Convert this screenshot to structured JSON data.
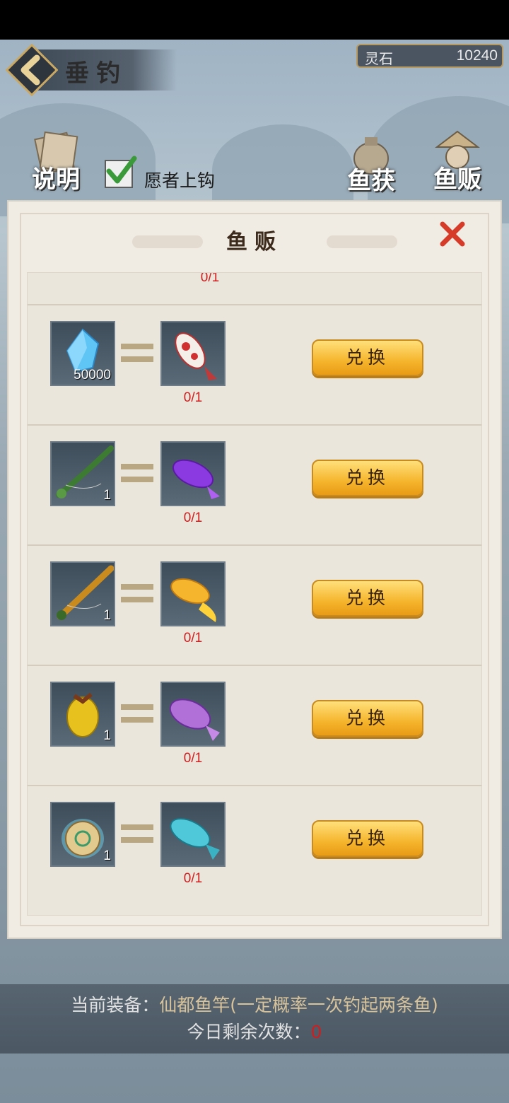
{
  "header": {
    "title": "垂钓",
    "currency_label": "灵石",
    "currency_value": "10240"
  },
  "toolbar": {
    "help_label": "说明",
    "catch_label": "鱼获",
    "vendor_label": "鱼贩",
    "auto_hook_label": "愿者上钩",
    "auto_hook_checked": true
  },
  "modal": {
    "title": "鱼贩",
    "top_partial_progress": "0/1",
    "exchange_label": "兑换",
    "rows": [
      {
        "cost_icon": "spirit-crystal-icon",
        "cost_count": "50000",
        "reward_icon": "koi-fish-icon",
        "progress": "0/1"
      },
      {
        "cost_icon": "green-bamboo-rod-icon",
        "cost_count": "1",
        "reward_icon": "purple-arowana-icon",
        "progress": "0/1"
      },
      {
        "cost_icon": "golden-rod-icon",
        "cost_count": "1",
        "reward_icon": "golden-arowana-icon",
        "progress": "0/1"
      },
      {
        "cost_icon": "golden-fruit-bait-icon",
        "cost_count": "1",
        "reward_icon": "purple-carp-icon",
        "progress": "0/1"
      },
      {
        "cost_icon": "jade-pouch-icon",
        "cost_count": "1",
        "reward_icon": "cyan-carp-icon",
        "progress": "0/1"
      }
    ]
  },
  "footer": {
    "equip_label": "当前装备：",
    "equip_value": "仙都鱼竿(一定概率一次钓起两条鱼)",
    "remaining_label": "今日剩余次数：",
    "remaining_value": "0"
  },
  "colors": {
    "accent_gold": "#f5b52c",
    "progress_red": "#cc1f1f",
    "panel_bg": "#f0ece4"
  }
}
